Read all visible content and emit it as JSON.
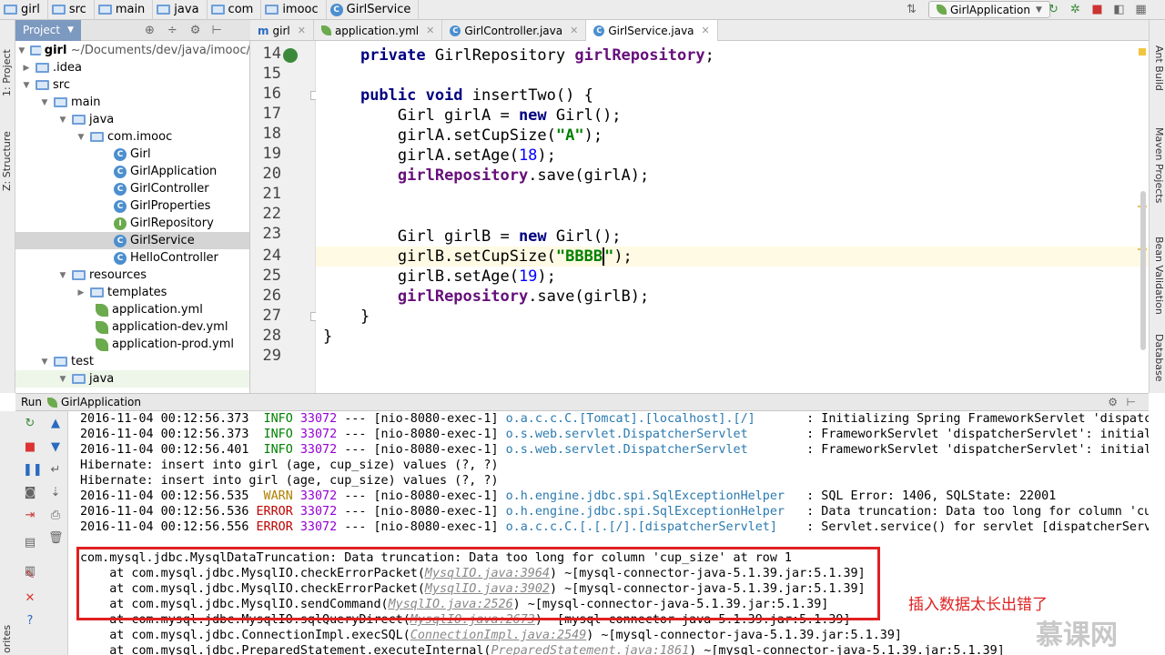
{
  "breadcrumb": [
    "girl",
    "src",
    "main",
    "java",
    "com",
    "imooc",
    "GirlService"
  ],
  "run_config": "GirlApplication",
  "toolwindows": {
    "left": [
      "1: Project",
      "Z: Structure"
    ],
    "right": [
      "Ant Build",
      "Maven Projects",
      "Bean Validation",
      "Database"
    ],
    "bottom_left": "orites"
  },
  "project": {
    "tab": "Project",
    "root_name": "girl",
    "root_path": "~/Documents/dev/java/imooc/",
    "items": [
      {
        "label": "girl ~/Documents/dev/java/imooc/",
        "type": "module",
        "depth": 0,
        "expanded": true
      },
      {
        "label": ".idea",
        "type": "folder",
        "depth": 1,
        "expanded": false
      },
      {
        "label": "src",
        "type": "folder",
        "depth": 1,
        "expanded": true
      },
      {
        "label": "main",
        "type": "folder",
        "depth": 2,
        "expanded": true
      },
      {
        "label": "java",
        "type": "folder-blue",
        "depth": 3,
        "expanded": true
      },
      {
        "label": "com.imooc",
        "type": "package",
        "depth": 4,
        "expanded": true
      },
      {
        "label": "Girl",
        "type": "class",
        "depth": 5
      },
      {
        "label": "GirlApplication",
        "type": "class-app",
        "depth": 5
      },
      {
        "label": "GirlController",
        "type": "class",
        "depth": 5
      },
      {
        "label": "GirlProperties",
        "type": "class",
        "depth": 5
      },
      {
        "label": "GirlRepository",
        "type": "interface",
        "depth": 5
      },
      {
        "label": "GirlService",
        "type": "class",
        "depth": 5,
        "selected": true
      },
      {
        "label": "HelloController",
        "type": "class",
        "depth": 5
      },
      {
        "label": "resources",
        "type": "folder-res",
        "depth": 3,
        "expanded": true
      },
      {
        "label": "templates",
        "type": "folder",
        "depth": 4,
        "expanded": false
      },
      {
        "label": "application.yml",
        "type": "yml",
        "depth": 4
      },
      {
        "label": "application-dev.yml",
        "type": "yml",
        "depth": 4
      },
      {
        "label": "application-prod.yml",
        "type": "yml",
        "depth": 4
      },
      {
        "label": "test",
        "type": "folder",
        "depth": 1,
        "expanded": true
      },
      {
        "label": "java",
        "type": "folder-green",
        "depth": 2,
        "expanded": true
      }
    ]
  },
  "editor_tabs": [
    {
      "label": "girl",
      "icon": "m",
      "active": false
    },
    {
      "label": "application.yml",
      "icon": "yml",
      "active": false
    },
    {
      "label": "GirlController.java",
      "icon": "c",
      "active": false
    },
    {
      "label": "GirlService.java",
      "icon": "c",
      "active": true
    }
  ],
  "code": {
    "line_numbers": [
      "14",
      "15",
      "16",
      "17",
      "18",
      "19",
      "20",
      "21",
      "22",
      "23",
      "24",
      "25",
      "26",
      "27",
      "28",
      "29"
    ],
    "current_line": "24"
  },
  "run_panel": {
    "label": "Run",
    "config": "GirlApplication"
  },
  "console": {
    "log_lines": [
      {
        "ts": "2016-11-04 00:12:56.373",
        "level": "INFO",
        "pid": "33072",
        "sep": "---",
        "thread": "[nio-8080-exec-1]",
        "logger": "o.a.c.c.C.[Tomcat].[localhost].[/]      ",
        "msg": ": Initializing Spring FrameworkServlet 'dispatc"
      },
      {
        "ts": "2016-11-04 00:12:56.373",
        "level": "INFO",
        "pid": "33072",
        "sep": "---",
        "thread": "[nio-8080-exec-1]",
        "logger": "o.s.web.servlet.DispatcherServlet       ",
        "msg": ": FrameworkServlet 'dispatcherServlet': initial"
      },
      {
        "ts": "2016-11-04 00:12:56.401",
        "level": "INFO",
        "pid": "33072",
        "sep": "---",
        "thread": "[nio-8080-exec-1]",
        "logger": "o.s.web.servlet.DispatcherServlet       ",
        "msg": ": FrameworkServlet 'dispatcherServlet': initial"
      }
    ],
    "hibernate_lines": [
      "Hibernate: insert into girl (age, cup_size) values (?, ?)",
      "Hibernate: insert into girl (age, cup_size) values (?, ?)"
    ],
    "log_lines2": [
      {
        "ts": "2016-11-04 00:12:56.535",
        "level": " WARN",
        "pid": "33072",
        "sep": "---",
        "thread": "[nio-8080-exec-1]",
        "logger": "o.h.engine.jdbc.spi.SqlExceptionHelper  ",
        "msg": ": SQL Error: 1406, SQLState: 22001"
      },
      {
        "ts": "2016-11-04 00:12:56.536",
        "level": "ERROR",
        "pid": "33072",
        "sep": "---",
        "thread": "[nio-8080-exec-1]",
        "logger": "o.h.engine.jdbc.spi.SqlExceptionHelper  ",
        "msg": ": Data truncation: Data too long for column 'cu"
      },
      {
        "ts": "2016-11-04 00:12:56.556",
        "level": "ERROR",
        "pid": "33072",
        "sep": "---",
        "thread": "[nio-8080-exec-1]",
        "logger": "o.a.c.c.C.[.[.[/].[dispatcherServlet]   ",
        "msg": ": Servlet.service() for servlet [dispatcherServ"
      }
    ],
    "exception": "com.mysql.jdbc.MysqlDataTruncation: Data truncation: Data too long for column 'cup_size' at row 1",
    "stack": [
      {
        "prefix": "    at com.mysql.jdbc.MysqlIO.checkErrorPacket(",
        "link": "MysqlIO.java:3964",
        "suffix": ") ~[mysql-connector-java-5.1.39.jar:5.1.39]"
      },
      {
        "prefix": "    at com.mysql.jdbc.MysqlIO.checkErrorPacket(",
        "link": "MysqlIO.java:3902",
        "suffix": ") ~[mysql-connector-java-5.1.39.jar:5.1.39]"
      },
      {
        "prefix": "    at com.mysql.jdbc.MysqlIO.sendCommand(",
        "link": "MysqlIO.java:2526",
        "suffix": ") ~[mysql-connector-java-5.1.39.jar:5.1.39]"
      },
      {
        "prefix": "    at com.mysql.jdbc.MysqlIO.sqlQueryDirect(",
        "link": "MysqlIO.java:2673",
        "suffix": ") ~[mysql-connector-java-5.1.39.jar:5.1.39]"
      },
      {
        "prefix": "    at com.mysql.jdbc.ConnectionImpl.execSQL(",
        "link": "ConnectionImpl.java:2549",
        "suffix": ") ~[mysql-connector-java-5.1.39.jar:5.1.39]"
      },
      {
        "prefix": "    at com.mysql.jdbc.PreparedStatement.executeInternal(",
        "link": "PreparedStatement.java:1861",
        "suffix": ") ~[mysql-connector-java-5.1.39.jar:5.1.39]"
      }
    ]
  },
  "annotation": "插入数据太长出错了",
  "watermark": "慕课网",
  "colors": {
    "accent": "#7c99c0",
    "error": "#c00000",
    "annotation": "#e02020"
  }
}
